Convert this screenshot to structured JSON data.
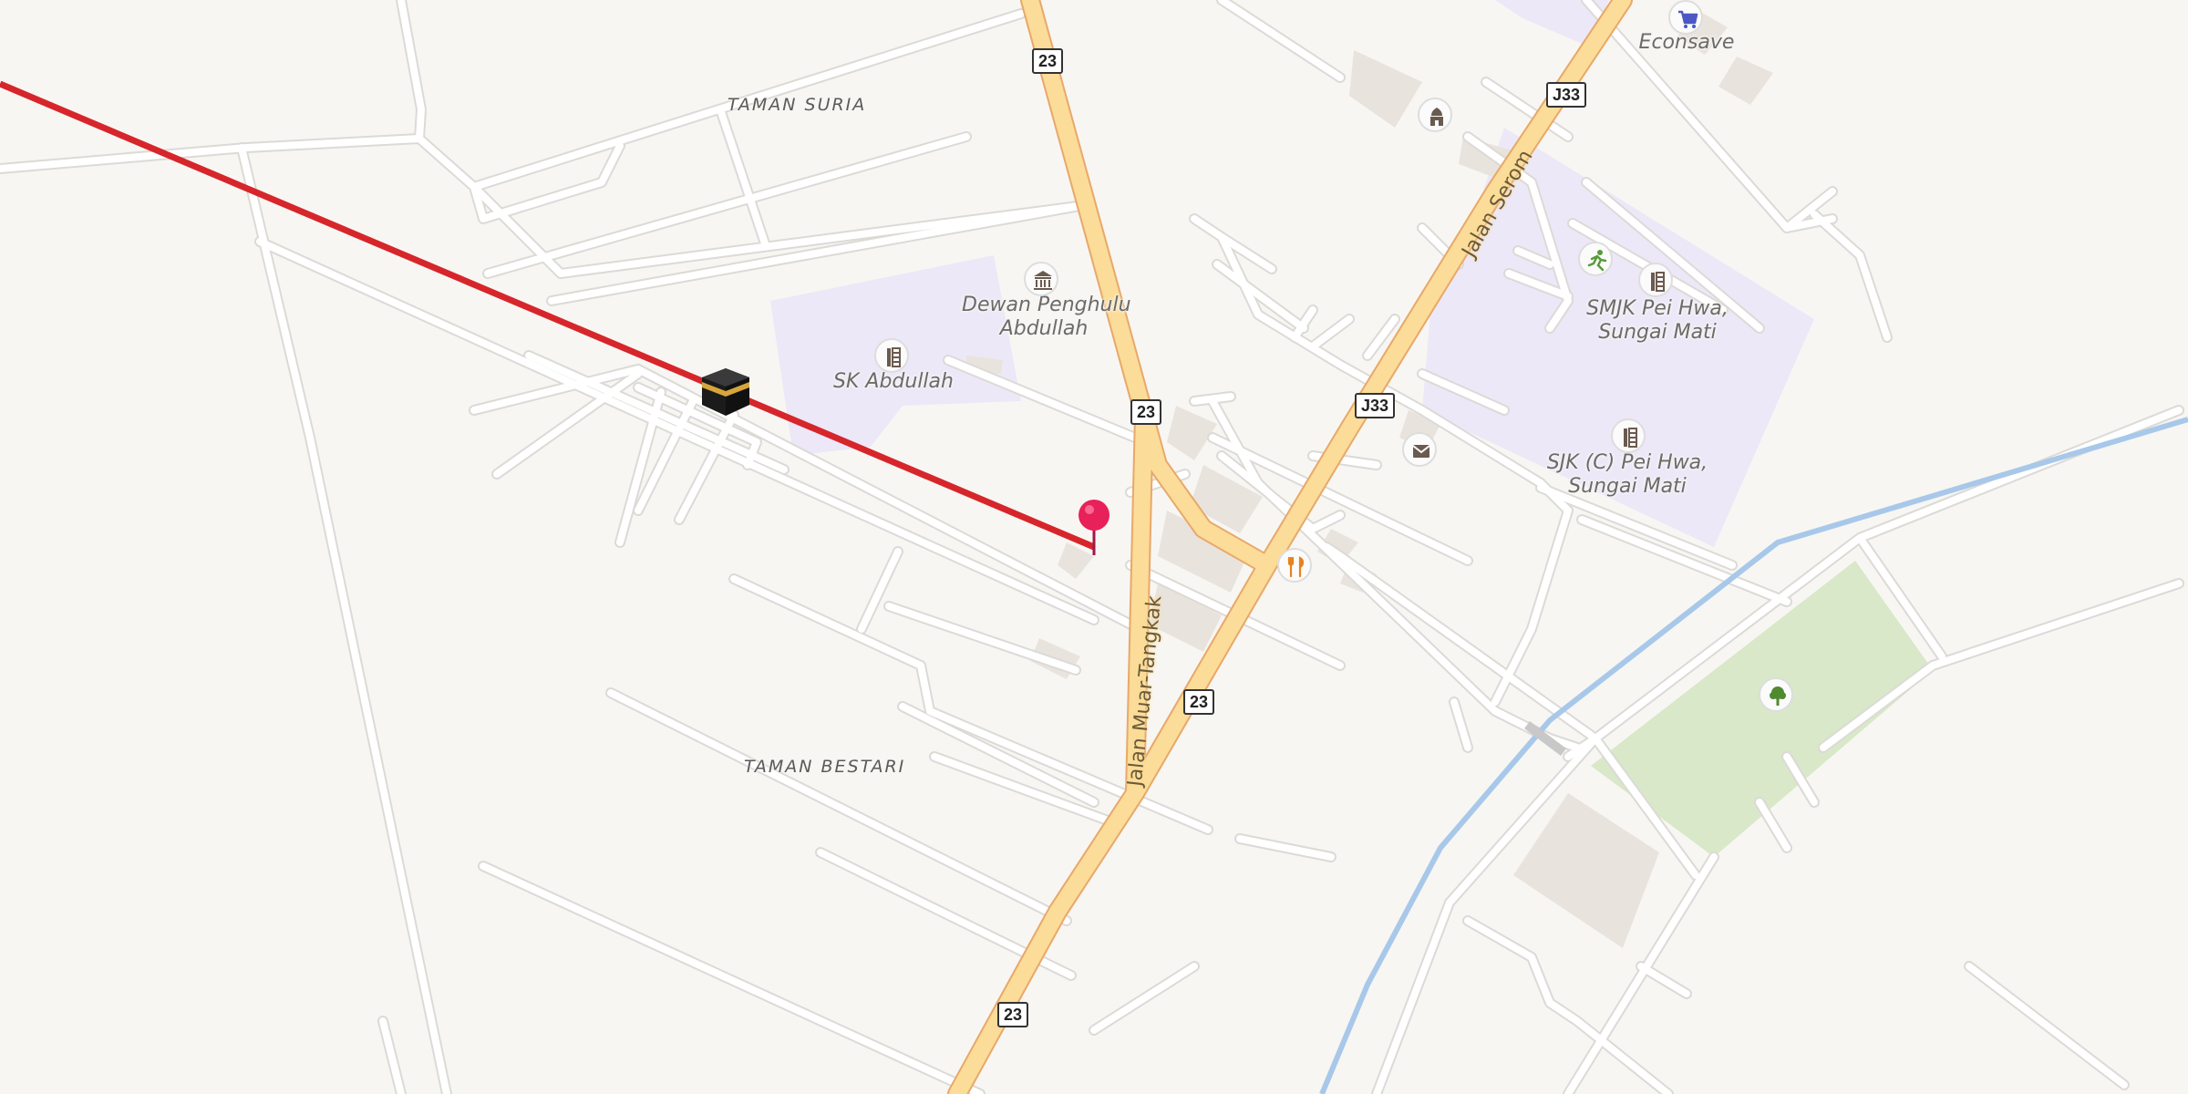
{
  "map": {
    "areas": {
      "taman_suria": "TAMAN SURIA",
      "taman_bestari": "TAMAN BESTARI"
    },
    "places": {
      "dewan": "Dewan Penghulu\nAbdullah",
      "sk_abdullah": "SK Abdullah",
      "smjk": "SMJK Pei Hwa,\nSungai Mati",
      "sjk": "SJK (C) Pei Hwa,\nSungai Mati",
      "econsave": "Econsave"
    },
    "roads": {
      "jalan_muar_tangkak": "Jalan Muar-Tangkak",
      "jalan_serom": "Jalan Serom"
    },
    "shields": {
      "r23_a": "23",
      "r23_b": "23",
      "r23_c": "23",
      "r23_d": "23",
      "j33_a": "J33",
      "j33_b": "J33"
    },
    "icons": {
      "kaaba": "kaaba-icon",
      "pin": "location-pin-icon",
      "school_a": "school-icon",
      "school_b": "school-icon",
      "school_c": "school-icon",
      "town_hall": "town-hall-icon",
      "mosque": "mosque-icon",
      "shopping": "shopping-cart-icon",
      "sports": "sports-icon",
      "post": "post-office-icon",
      "restaurant": "restaurant-icon",
      "park": "park-tree-icon"
    },
    "colors": {
      "background": "#f8f6f2",
      "minor_road": "#ffffff",
      "major_road": "#fbdc98",
      "major_road_casing": "#e8a86a",
      "qibla_line": "#d6262b",
      "waterway": "#a8c8ea",
      "school_area": "#ece8f8",
      "park_area": "#d8e8c8",
      "building": "#e9e3dd",
      "pin": "#e8215a"
    }
  }
}
